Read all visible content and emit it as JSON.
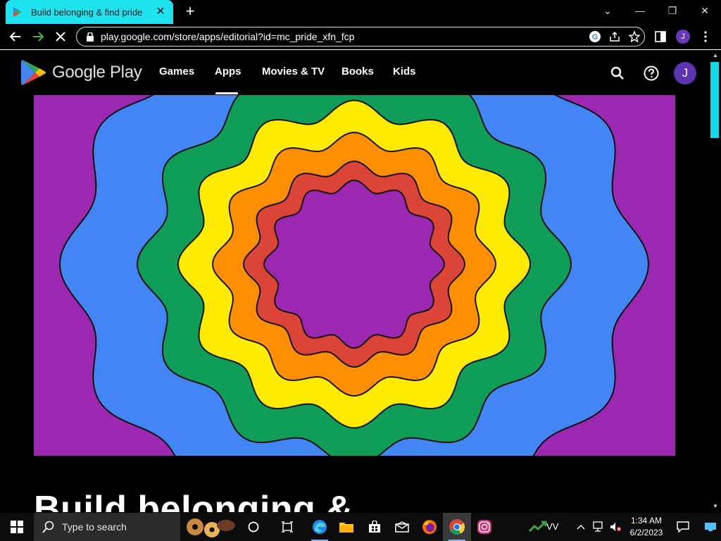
{
  "browser": {
    "tab_title": "Build belonging & find pride",
    "tab_close": "✕",
    "new_tab": "+",
    "url": "play.google.com/store/apps/editorial?id=mc_pride_xfn_fcp",
    "profile_initial": "J"
  },
  "window_controls": {
    "dropdown": "⌄",
    "minimize": "—",
    "restore": "❐",
    "close": "✕"
  },
  "play": {
    "brand": "Google Play",
    "nav": [
      "Games",
      "Apps",
      "Movies & TV",
      "Books",
      "Kids"
    ],
    "active_nav": "Apps",
    "avatar_initial": "J"
  },
  "hero": {
    "background": "#9c27b0",
    "rings": [
      "#4285f4",
      "#0f9d58",
      "#ffeb00",
      "#ff8f00",
      "#db4437",
      "#9c27b0"
    ]
  },
  "page": {
    "title": "Build belonging &"
  },
  "taskbar": {
    "search_placeholder": "Type to search",
    "tray_label": "VV",
    "time": "1:34 AM",
    "date": "6/2/2023"
  }
}
